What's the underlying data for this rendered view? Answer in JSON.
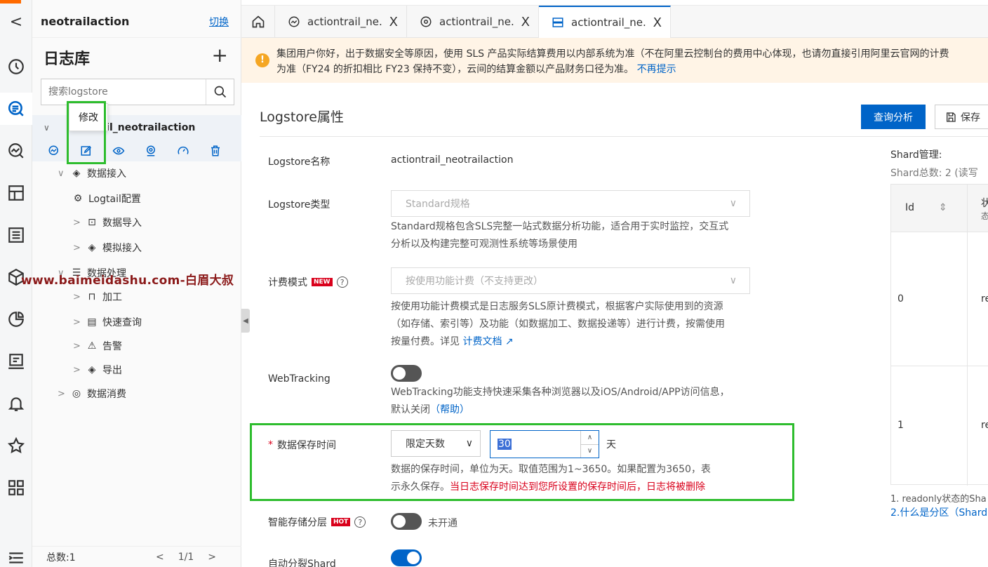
{
  "colors": {
    "accent": "#0064c8",
    "highlight": "#2ebd2e",
    "warning": "#f5a623",
    "danger": "#d9001b"
  },
  "rail": {
    "back_glyph": "<",
    "icons": [
      "clock-icon",
      "search-logstore-icon",
      "analysis-icon",
      "dashboard-icon",
      "list-icon",
      "cube-icon",
      "pie-chart-icon",
      "report-icon",
      "bell-icon",
      "star-icon",
      "grid-icon",
      "menu-icon"
    ]
  },
  "sidebar": {
    "project_name": "neotrailaction",
    "switch_label": "切换",
    "title": "日志库",
    "add_glyph": "+",
    "search_placeholder": "搜索logstore",
    "tooltip": "修改",
    "logstore_name": "rail_neotrailaction",
    "tree": {
      "data_ingest": "数据接入",
      "logtail_config": "Logtail配置",
      "data_import": "数据导入",
      "simulated_ingest": "模拟接入",
      "data_processing": "数据处理",
      "processing": "加工",
      "quick_query": "快速查询",
      "alert": "告警",
      "export": "导出",
      "data_consume": "数据消费"
    },
    "footer": {
      "total": "总数:1",
      "page": "1/1",
      "prev_glyph": "<",
      "next_glyph": ">"
    }
  },
  "watermark": "www.baimeidashu.com-白眉大叔",
  "tabs": [
    {
      "label": "actiontrail_ne...",
      "icon": "analysis-icon"
    },
    {
      "label": "actiontrail_ne...",
      "icon": "target-icon"
    },
    {
      "label": "actiontrail_ne...",
      "icon": "storage-icon"
    }
  ],
  "tab_close_glyph": "X",
  "notice": {
    "line1": "集团用户你好，出于数据安全等原因，使用 SLS 产品实际结算费用以内部系统为准（不在阿里云控制台的费用中心体现，也请勿直接引用阿里云官网的计费",
    "line2": "为准（FY24 的折扣相比 FY23 保持不变），云间的结算金额以产品财务口径为准。",
    "dismiss": "不再提示"
  },
  "main": {
    "title": "Logstore属性",
    "query_button": "查询分析",
    "save_button": "保存",
    "fields": {
      "name_label": "Logstore名称",
      "name_value": "actiontrail_neotrailaction",
      "type_label": "Logstore类型",
      "type_value": "Standard规格",
      "type_help_1": "Standard规格包含SLS完整一站式数据分析功能，适合用于实时监控，交互式",
      "type_help_2": "分析以及构建完整可观测性系统等场景使用",
      "billing_label": "计费模式",
      "billing_badge": "NEW",
      "billing_value": "按使用功能计费（不支持更改）",
      "billing_help_1": "按使用功能计费模式是日志服务SLS原计费模式，根据客户实际使用到的资源",
      "billing_help_2": "（如存储、索引等）及功能（如数据加工、数据投递等）进行计费，按需使用",
      "billing_help_3": "按量付费。详见",
      "billing_doc_link": "计费文档",
      "webtracking_label": "WebTracking",
      "webtracking_help_1": "WebTracking功能支持快速采集各种浏览器以及iOS/Android/APP访问信息，",
      "webtracking_help_2": "默认关闭",
      "webtracking_help_link": "（帮助）",
      "retention_required": "*",
      "retention_label": "数据保存时间",
      "retention_mode": "限定天数",
      "retention_value": "30",
      "retention_unit": "天",
      "retention_help_1": "数据的保存时间，单位为天。取值范围为1~3650。如果配置为3650，表",
      "retention_help_2": "示永久保存。",
      "retention_warning": "当日志保存时间达到您所设置的保存时间后，日志将被删除",
      "tiering_label": "智能存储分层",
      "tiering_badge": "HOT",
      "tiering_status": "未开通",
      "autosplit_label": "自动分裂Shard"
    },
    "toggles": {
      "webtracking_on": false,
      "tiering_on": false,
      "autosplit_on": true
    }
  },
  "shard": {
    "title": "Shard管理:",
    "count": "Shard总数:  2   (读写",
    "col_id": "Id",
    "col_status_1": "状",
    "col_status_2": "态",
    "rows": [
      {
        "id": "0",
        "status": "re"
      },
      {
        "id": "1",
        "status": "re"
      }
    ],
    "note1": "1. readonly状态的Sha",
    "note2": "2.什么是分区（Shard"
  }
}
